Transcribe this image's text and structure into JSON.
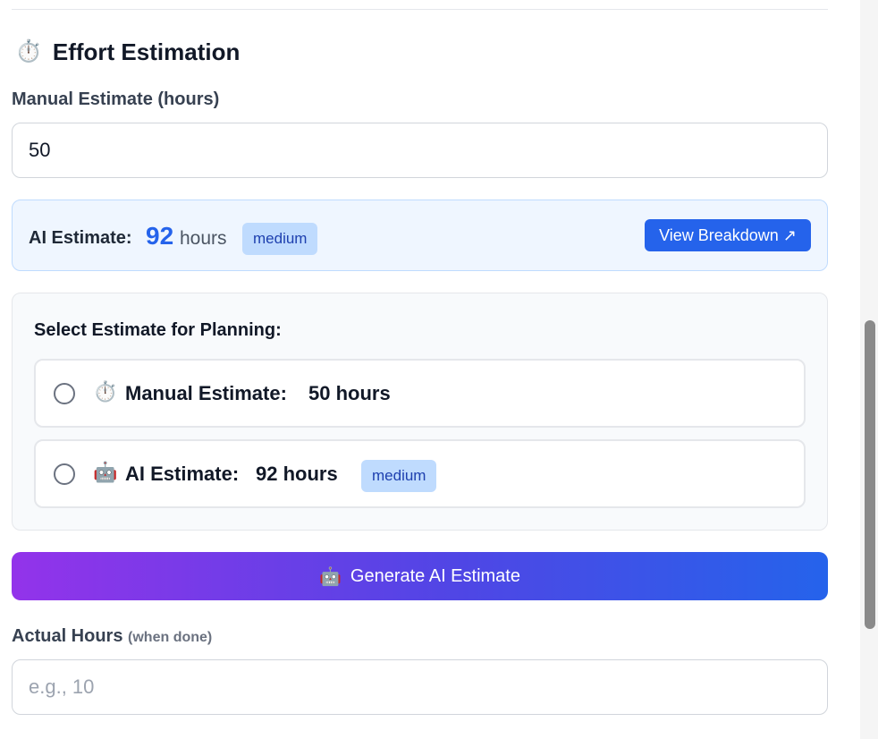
{
  "section": {
    "icon": "stopwatch-icon",
    "emoji": "⏱️",
    "title": "Effort Estimation"
  },
  "manual": {
    "label": "Manual Estimate (hours)",
    "value": "50"
  },
  "ai_estimate": {
    "label": "AI Estimate:",
    "value": "92",
    "unit": "hours",
    "confidence": "medium",
    "view_button": "View Breakdown ↗"
  },
  "selection": {
    "title": "Select Estimate for Planning:",
    "options": [
      {
        "icon": "stopwatch-icon",
        "emoji": "⏱️",
        "label": "Manual Estimate:",
        "value": "50 hours"
      },
      {
        "icon": "robot-icon",
        "emoji": "🤖",
        "label": "AI Estimate:",
        "value": "92 hours",
        "badge": "medium"
      }
    ]
  },
  "generate_button": {
    "icon": "robot-icon",
    "emoji": "🤖",
    "label": "Generate AI Estimate"
  },
  "actual": {
    "label": "Actual Hours",
    "hint": "(when done)",
    "placeholder": "e.g., 10",
    "value": ""
  },
  "colors": {
    "primary": "#2563eb",
    "gradient_start": "#9333ea",
    "gradient_end": "#2563eb",
    "badge_bg": "#bfdbfe"
  }
}
